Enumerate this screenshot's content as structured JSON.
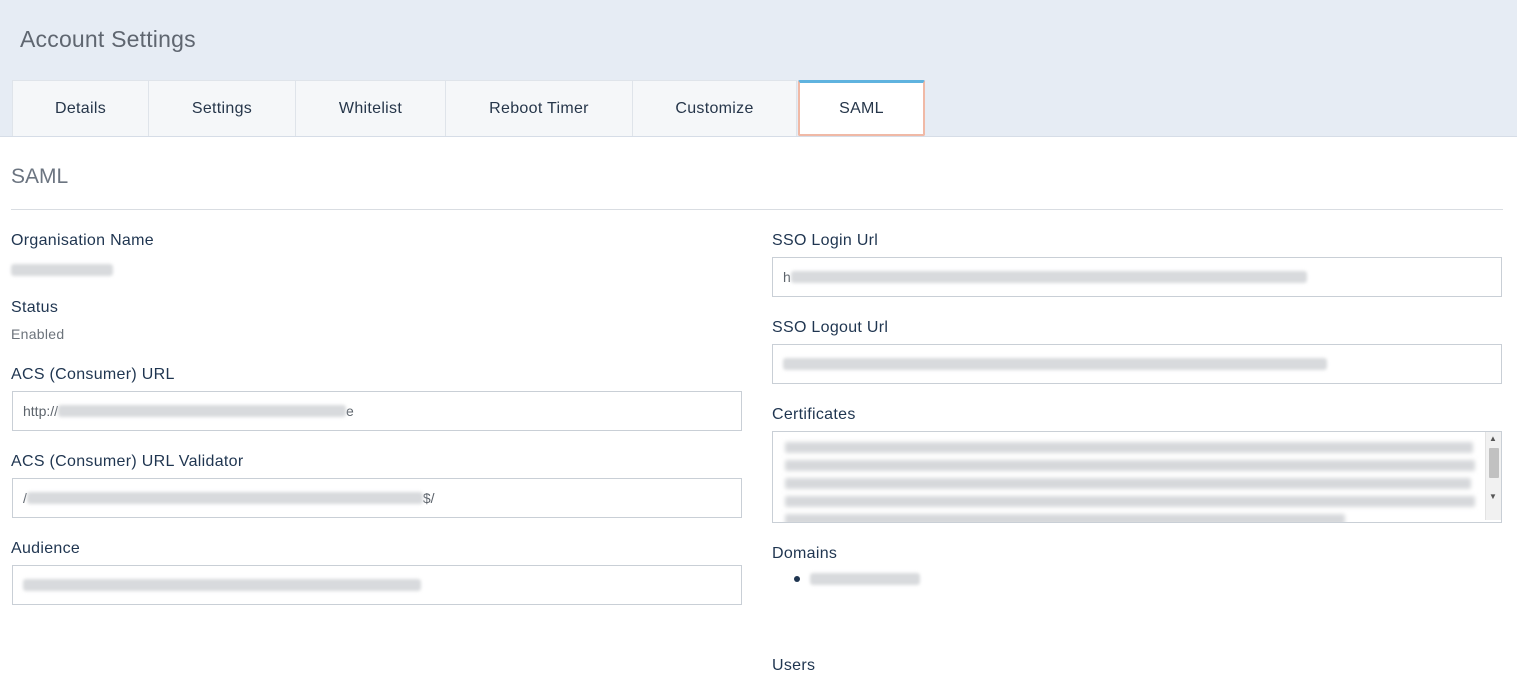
{
  "page": {
    "title": "Account Settings"
  },
  "tabs": [
    {
      "label": "Details"
    },
    {
      "label": "Settings"
    },
    {
      "label": "Whitelist"
    },
    {
      "label": "Reboot Timer"
    },
    {
      "label": "Customize"
    },
    {
      "label": "SAML",
      "active": true
    }
  ],
  "section": {
    "title": "SAML"
  },
  "left": {
    "org_name_label": "Organisation Name",
    "status_label": "Status",
    "status_value": "Enabled",
    "acs_url_label": "ACS (Consumer) URL",
    "acs_url_value_start": "http://",
    "acs_url_value_end": "e",
    "acs_validator_label": "ACS (Consumer) URL Validator",
    "acs_validator_value_start": "/",
    "acs_validator_value_end": "$/",
    "audience_label": "Audience"
  },
  "right": {
    "sso_login_label": "SSO Login Url",
    "sso_login_value_start": "h",
    "sso_logout_label": "SSO Logout Url",
    "certificates_label": "Certificates",
    "domains_label": "Domains",
    "users_label": "Users"
  },
  "colors": {
    "accent_tab_top": "#5fb3df",
    "accent_tab_border": "#f0b9a6",
    "header_bg": "#e6ecf4"
  }
}
